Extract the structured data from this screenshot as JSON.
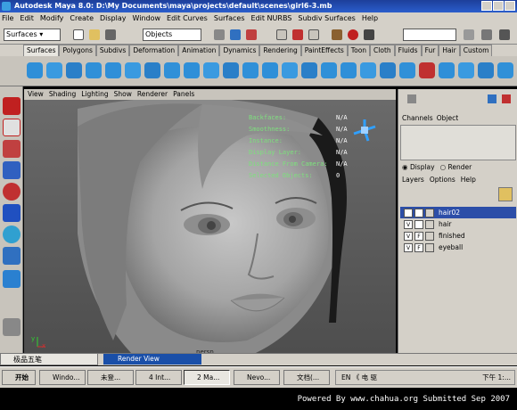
{
  "window": {
    "title": "Autodesk Maya 8.0: D:\\My Documents\\maya\\projects\\default\\scenes\\girl6-3.mb"
  },
  "menu": [
    "File",
    "Edit",
    "Modify",
    "Create",
    "Display",
    "Window",
    "Edit Curves",
    "Surfaces",
    "Edit NURBS",
    "Subdiv Surfaces",
    "Help"
  ],
  "status_line": {
    "menu_set": "Surfaces",
    "selection_mode": "Objects"
  },
  "shelf_tabs": [
    "Surfaces",
    "Polygons",
    "Subdivs",
    "Deformation",
    "Animation",
    "Dynamics",
    "Rendering",
    "PaintEffects",
    "Toon",
    "Cloth",
    "Fluids",
    "Fur",
    "Hair",
    "Custom"
  ],
  "viewport": {
    "menu": [
      "View",
      "Shading",
      "Lighting",
      "Show",
      "Renderer",
      "Panels"
    ],
    "hud": [
      {
        "label": "Backfaces:",
        "value": "N/A"
      },
      {
        "label": "Smoothness:",
        "value": "N/A"
      },
      {
        "label": "Instance:",
        "value": "N/A"
      },
      {
        "label": "Display Layer:",
        "value": "N/A"
      },
      {
        "label": "Distance From Camera:",
        "value": "N/A"
      },
      {
        "label": "Selected Objects:",
        "value": "0"
      }
    ],
    "camera": "persp"
  },
  "channel_box": {
    "tabs": [
      "Channels",
      "Object"
    ]
  },
  "layer_editor": {
    "display_label": "Display",
    "render_label": "Render",
    "menu": [
      "Layers",
      "Options",
      "Help"
    ],
    "layers": [
      {
        "name": "hair02",
        "visible": "",
        "frozen": "F",
        "selected": true
      },
      {
        "name": "hair",
        "visible": "V",
        "frozen": "",
        "selected": false
      },
      {
        "name": "finished",
        "visible": "V",
        "frozen": "F",
        "selected": false
      },
      {
        "name": "eyeball",
        "visible": "V",
        "frozen": "F",
        "selected": false
      }
    ]
  },
  "bottom": {
    "ime_text": "极品五笔",
    "render_view": "Render View"
  },
  "taskbar": {
    "start": "开始",
    "buttons": [
      "Windo...",
      "未登...",
      "4 Int...",
      "2 Ma...",
      "Nevo...",
      "文档(..."
    ],
    "tray_text": "EN  《 电 驱",
    "clock": "下午 1:..."
  },
  "footer": "Powered By www.chahua.org  Submitted Sep 2007"
}
